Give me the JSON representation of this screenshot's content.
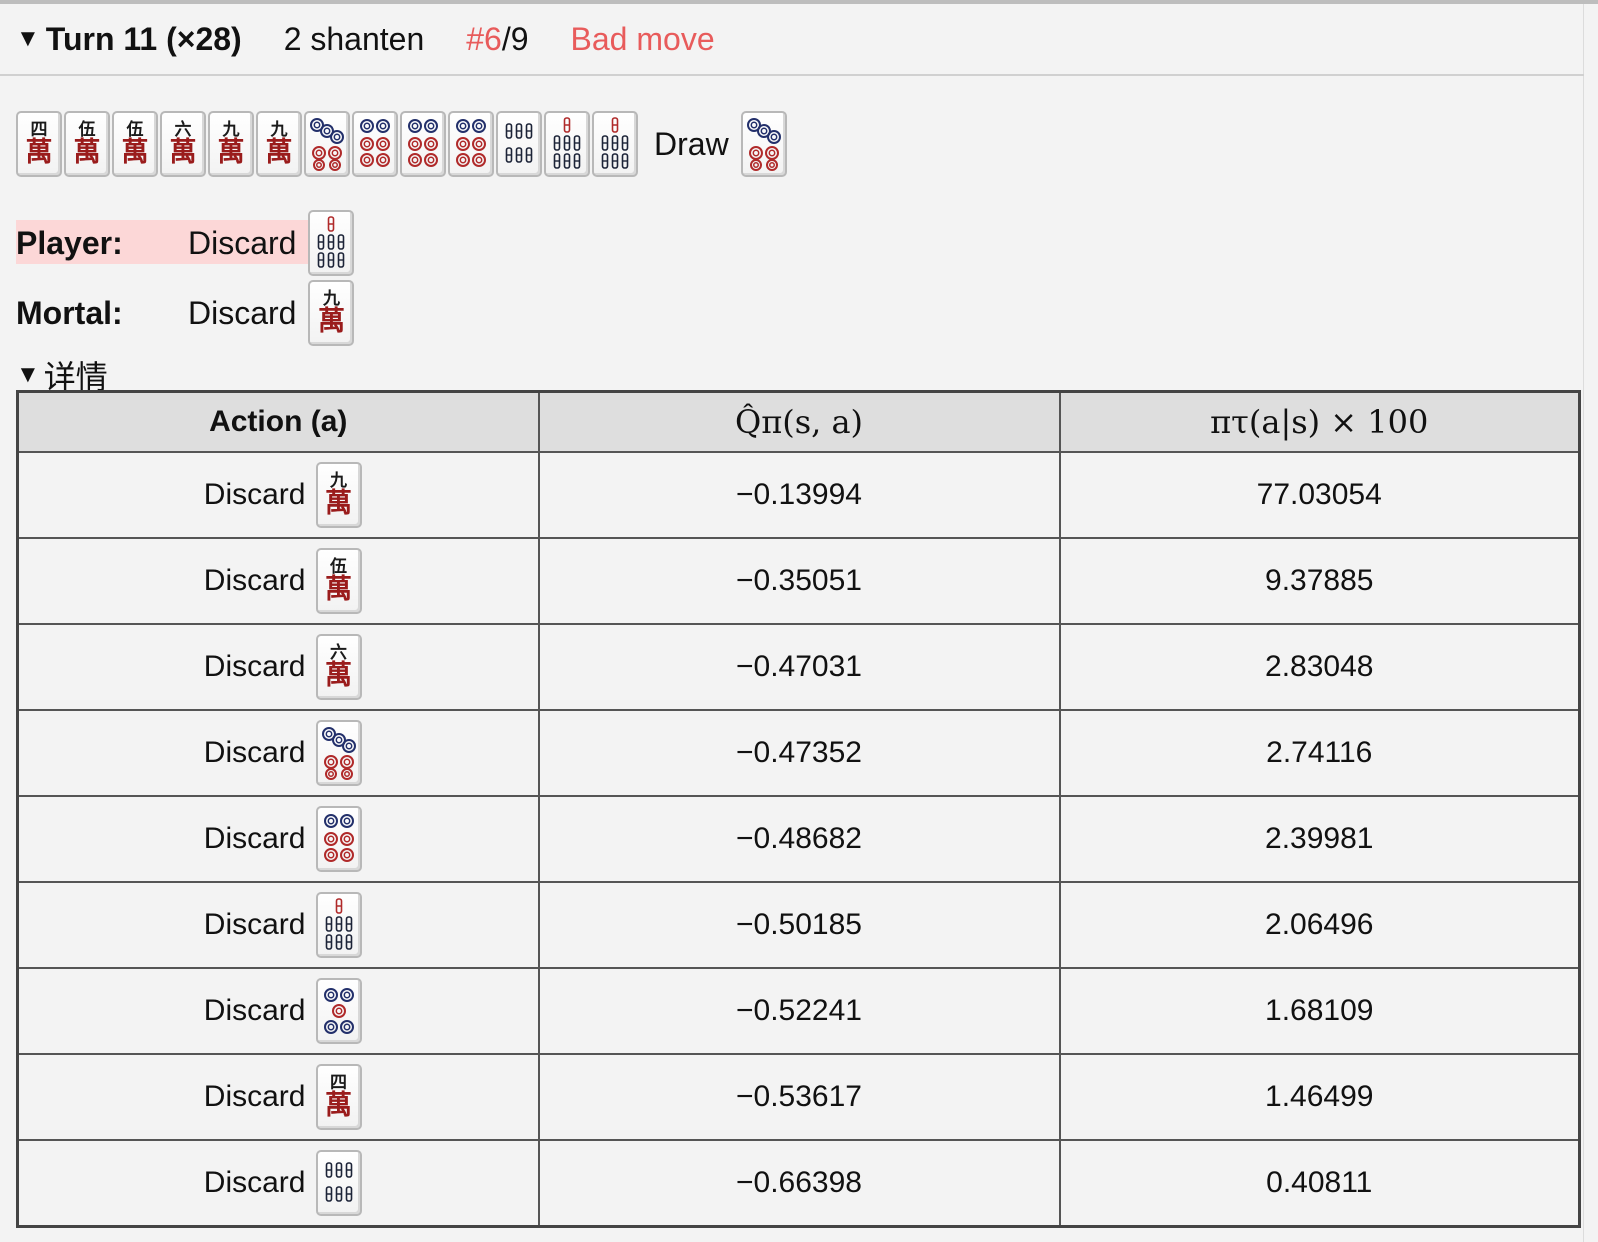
{
  "header": {
    "turn_label": "Turn 11 (×28)",
    "shanten": "2 shanten",
    "rank_current": "#6",
    "rank_total": "/9",
    "verdict": "Bad move",
    "accent": "#e85b5b"
  },
  "hand": {
    "tiles": [
      "4m",
      "5m",
      "5m",
      "6m",
      "9m",
      "9m",
      "5p",
      "6p",
      "6p",
      "6p",
      "6s",
      "7s",
      "7s"
    ],
    "draw_label": "Draw",
    "draw_tile": "5p"
  },
  "player": {
    "label": "Player:",
    "action": "Discard",
    "tile": "7s",
    "highlight": "#fcd7d7"
  },
  "mortal": {
    "label": "Mortal:",
    "action": "Discard",
    "tile": "9m"
  },
  "details": {
    "label": "详情"
  },
  "table": {
    "headers": [
      "Action (a)",
      "Q̂π(s, a)",
      "πτ(a|s) × 100"
    ],
    "rows": [
      {
        "action": "Discard",
        "tile": "9m",
        "q": "−0.13994",
        "pi": "77.03054"
      },
      {
        "action": "Discard",
        "tile": "5m",
        "q": "−0.35051",
        "pi": "9.37885"
      },
      {
        "action": "Discard",
        "tile": "6m",
        "q": "−0.47031",
        "pi": "2.83048"
      },
      {
        "action": "Discard",
        "tile": "5p",
        "q": "−0.47352",
        "pi": "2.74116"
      },
      {
        "action": "Discard",
        "tile": "6p",
        "q": "−0.48682",
        "pi": "2.39981"
      },
      {
        "action": "Discard",
        "tile": "7s",
        "q": "−0.50185",
        "pi": "2.06496"
      },
      {
        "action": "Discard",
        "tile": "5p-plain",
        "q": "−0.52241",
        "pi": "1.68109"
      },
      {
        "action": "Discard",
        "tile": "4m",
        "q": "−0.53617",
        "pi": "1.46499"
      },
      {
        "action": "Discard",
        "tile": "6s",
        "q": "−0.66398",
        "pi": "0.40811"
      }
    ]
  }
}
